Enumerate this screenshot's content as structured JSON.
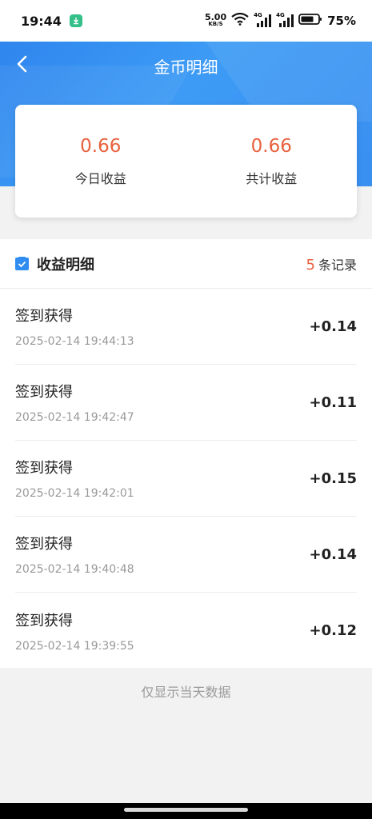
{
  "status_bar": {
    "time": "19:44",
    "net_speed_value": "5.00",
    "net_speed_unit": "KB/S",
    "signal_1": "4G",
    "signal_2": "4G",
    "battery_percent": "75%"
  },
  "header": {
    "title": "金币明细",
    "back_icon": "chevron-left-icon",
    "background_color": "#3a8ff0"
  },
  "summary": {
    "today_value": "0.66",
    "today_label": "今日收益",
    "total_value": "0.66",
    "total_label": "共计收益",
    "accent_color": "#e8603c"
  },
  "detail": {
    "section_title": "收益明细",
    "section_icon": "checkbox-icon",
    "record_count": "5",
    "record_count_label": "条记录",
    "records": [
      {
        "title": "签到获得",
        "time": "2025-02-14 19:44:13",
        "amount": "+0.14"
      },
      {
        "title": "签到获得",
        "time": "2025-02-14 19:42:47",
        "amount": "+0.11"
      },
      {
        "title": "签到获得",
        "time": "2025-02-14 19:42:01",
        "amount": "+0.15"
      },
      {
        "title": "签到获得",
        "time": "2025-02-14 19:40:48",
        "amount": "+0.14"
      },
      {
        "title": "签到获得",
        "time": "2025-02-14 19:39:55",
        "amount": "+0.12"
      }
    ]
  },
  "footer": {
    "note": "仅显示当天数据"
  }
}
